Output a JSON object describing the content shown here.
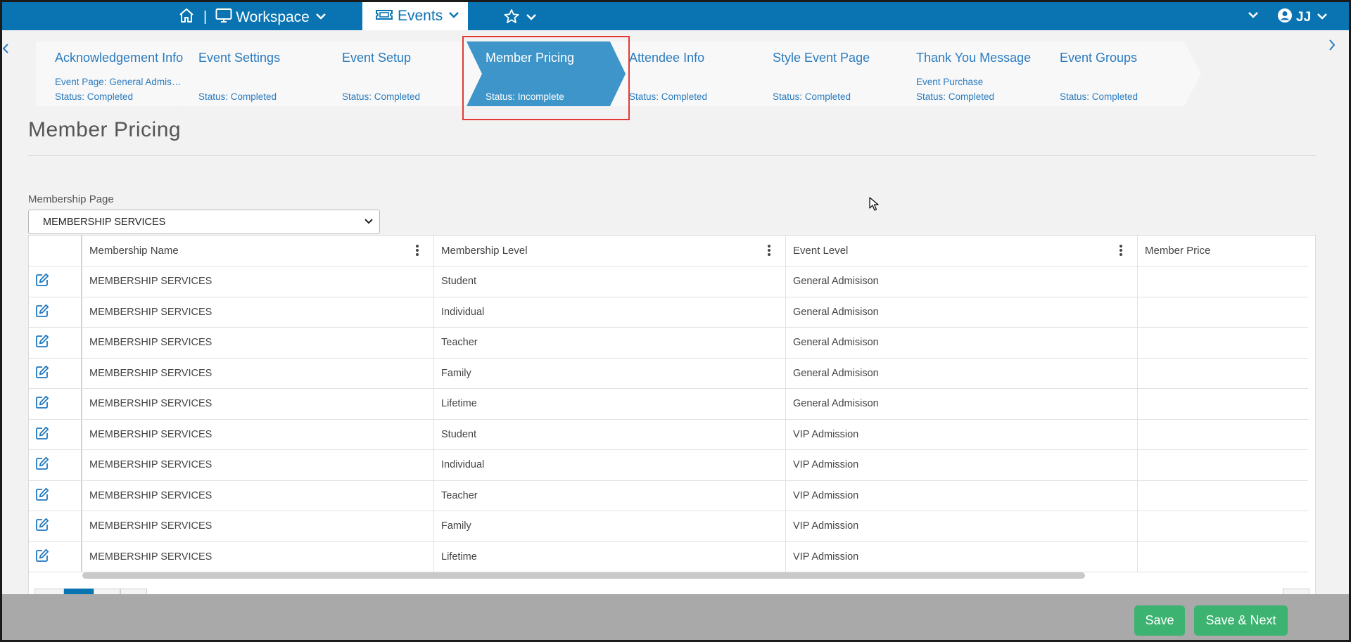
{
  "topnav": {
    "workspace_label": "Workspace",
    "events_label": "Events",
    "user_label": "JJ"
  },
  "steps": [
    {
      "title": "Acknowledgement Info",
      "sub": "Event Page: General Admission",
      "status": "Status: Completed"
    },
    {
      "title": "Event Settings",
      "sub": "",
      "status": "Status: Completed"
    },
    {
      "title": "Event Setup",
      "sub": "",
      "status": "Status: Completed"
    },
    {
      "title": "Member Pricing",
      "sub": "",
      "status": "Status: Incomplete"
    },
    {
      "title": "Attendee Info",
      "sub": "",
      "status": "Status: Completed"
    },
    {
      "title": "Style Event Page",
      "sub": "",
      "status": "Status: Completed"
    },
    {
      "title": "Thank You Message",
      "sub": "Event Purchase",
      "status": "Status: Completed"
    },
    {
      "title": "Event Groups",
      "sub": "",
      "status": "Status: Completed"
    }
  ],
  "page_title": "Member Pricing",
  "membership_page": {
    "label": "Membership Page",
    "selected": "MEMBERSHIP SERVICES"
  },
  "grid": {
    "columns": [
      "Membership Name",
      "Membership Level",
      "Event Level",
      "Member Price"
    ],
    "rows": [
      [
        "MEMBERSHIP SERVICES",
        "Student",
        "General Admisison",
        ""
      ],
      [
        "MEMBERSHIP SERVICES",
        "Individual",
        "General Admisison",
        ""
      ],
      [
        "MEMBERSHIP SERVICES",
        "Teacher",
        "General Admisison",
        ""
      ],
      [
        "MEMBERSHIP SERVICES",
        "Family",
        "General Admisison",
        ""
      ],
      [
        "MEMBERSHIP SERVICES",
        "Lifetime",
        "General Admisison",
        ""
      ],
      [
        "MEMBERSHIP SERVICES",
        "Student",
        "VIP Admission",
        ""
      ],
      [
        "MEMBERSHIP SERVICES",
        "Individual",
        "VIP Admission",
        ""
      ],
      [
        "MEMBERSHIP SERVICES",
        "Teacher",
        "VIP Admission",
        ""
      ],
      [
        "MEMBERSHIP SERVICES",
        "Family",
        "VIP Admission",
        ""
      ],
      [
        "MEMBERSHIP SERVICES",
        "Lifetime",
        "VIP Admission",
        ""
      ]
    ]
  },
  "footer": {
    "save_label": "Save",
    "save_next_label": "Save & Next"
  },
  "colors": {
    "nav_blue": "#0a74b3",
    "active_step": "#3d95c9",
    "link_blue": "#2a7bbf",
    "save_green": "#3cb371",
    "highlight_red": "#e53935"
  }
}
